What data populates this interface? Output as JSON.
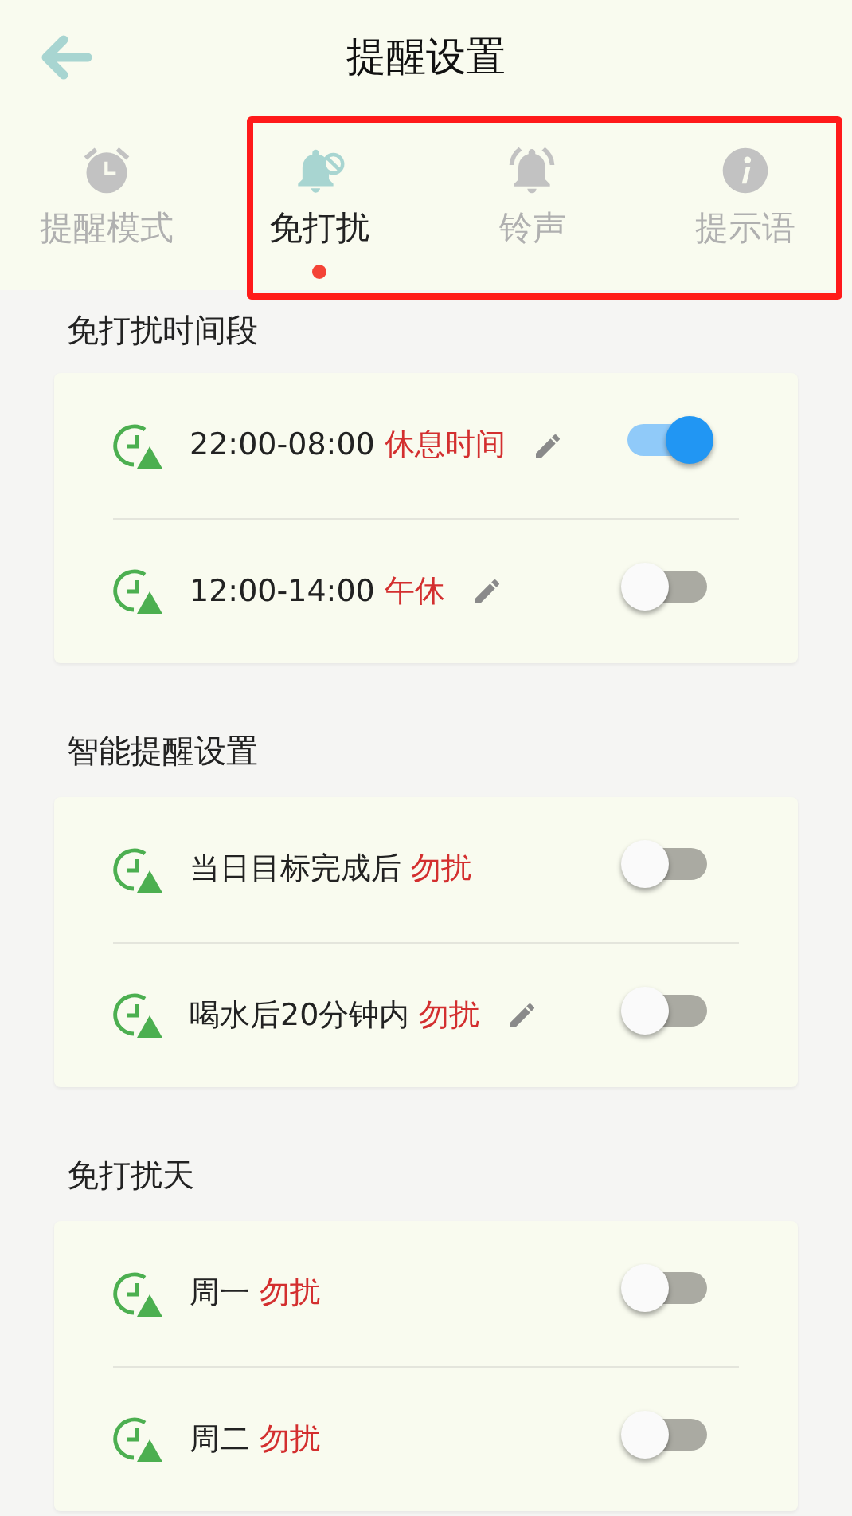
{
  "header": {
    "title": "提醒设置"
  },
  "tabs": [
    {
      "label": "提醒模式",
      "kind": "alarm",
      "selected": false
    },
    {
      "label": "免打扰",
      "kind": "mute",
      "selected": true
    },
    {
      "label": "铃声",
      "kind": "bell",
      "selected": false
    },
    {
      "label": "提示语",
      "kind": "info",
      "selected": false
    }
  ],
  "sections": [
    {
      "title": "免打扰时间段",
      "items": [
        {
          "text": "22:00-08:00",
          "tag": "休息时间",
          "editable": true,
          "on": true
        },
        {
          "text": "12:00-14:00",
          "tag": "午休",
          "editable": true,
          "on": false
        }
      ]
    },
    {
      "title": "智能提醒设置",
      "items": [
        {
          "text": "当日目标完成后",
          "tag": "勿扰",
          "editable": false,
          "on": false
        },
        {
          "text": "喝水后20分钟内",
          "tag": "勿扰",
          "editable": true,
          "on": false
        }
      ]
    },
    {
      "title": "免打扰天",
      "items": [
        {
          "text": "周一",
          "tag": "勿扰",
          "editable": false,
          "on": false
        },
        {
          "text": "周二",
          "tag": "勿扰",
          "editable": false,
          "on": false
        }
      ]
    }
  ]
}
